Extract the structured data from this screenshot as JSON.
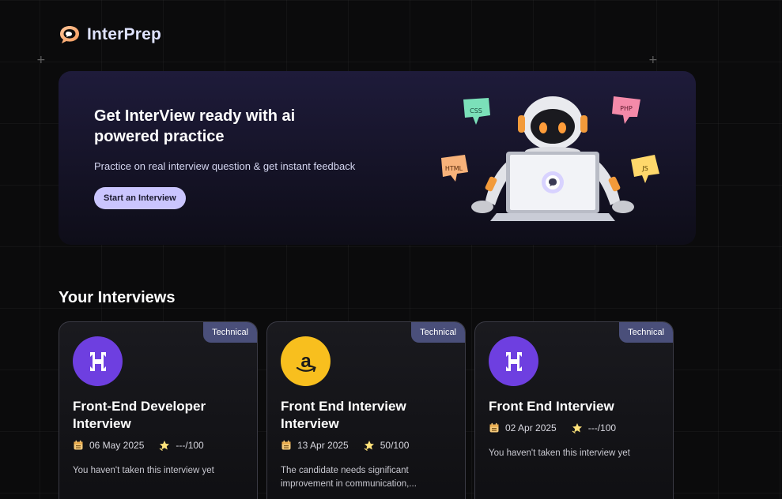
{
  "brand": {
    "name": "InterPrep"
  },
  "hero": {
    "title": "Get InterView ready with ai powered practice",
    "subtitle": "Practice on real interview question & get instant feedback",
    "cta_label": "Start an Interview",
    "tags": {
      "css": "CSS",
      "php": "PHP",
      "html": "HTML",
      "js": "JS"
    }
  },
  "interviews": {
    "title": "Your Interviews",
    "cards": [
      {
        "badge": "Technical",
        "company_icon": "hackerrank-logo-icon",
        "title": "Front-End Developer Interview",
        "date": "06 May 2025",
        "score": "---/100",
        "description": "You haven't taken this interview yet"
      },
      {
        "badge": "Technical",
        "company_icon": "amazon-logo-icon",
        "title": "Front End Interview Interview",
        "date": "13 Apr 2025",
        "score": "50/100",
        "description": "The candidate needs significant improvement in communication,..."
      },
      {
        "badge": "Technical",
        "company_icon": "hackerrank-logo-icon",
        "title": "Front End Interview",
        "date": "02 Apr 2025",
        "score": "---/100",
        "description": "You haven't taken this interview yet"
      }
    ]
  },
  "colors": {
    "background": "#0b0b0c",
    "accent": "#cac5fe",
    "badge": "#4a4f7a",
    "hackerrank_purple": "#6e3fe0",
    "amazon_yellow": "#f8bf1e"
  }
}
